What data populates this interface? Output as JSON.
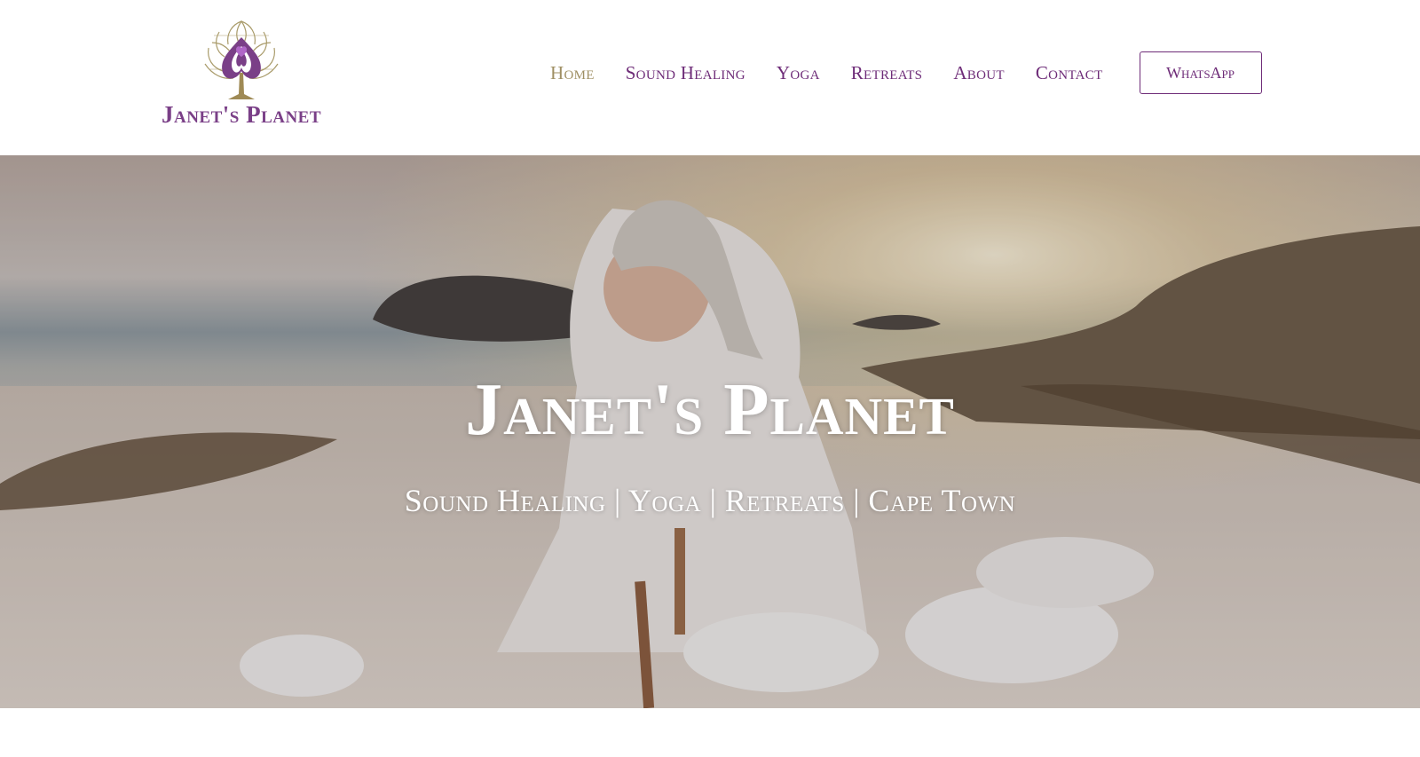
{
  "logo": {
    "text": "Janet's Planet",
    "icon": "lotus-tree-heart-icon"
  },
  "nav": {
    "items": [
      {
        "label": "Home",
        "active": true
      },
      {
        "label": "Sound Healing",
        "active": false
      },
      {
        "label": "Yoga",
        "active": false
      },
      {
        "label": "Retreats",
        "active": false
      },
      {
        "label": "About",
        "active": false
      },
      {
        "label": "Contact",
        "active": false
      }
    ],
    "cta_label": "WhatsApp"
  },
  "hero": {
    "title": "Janet's Planet",
    "subtitle": "Sound Healing | Yoga | Retreats | Cape Town",
    "image": "woman-with-singing-bowls-on-beach-at-sunset"
  },
  "colors": {
    "brand_purple": "#6e2c78",
    "active_gold": "#9f8f63",
    "hero_text": "#ffffff"
  }
}
